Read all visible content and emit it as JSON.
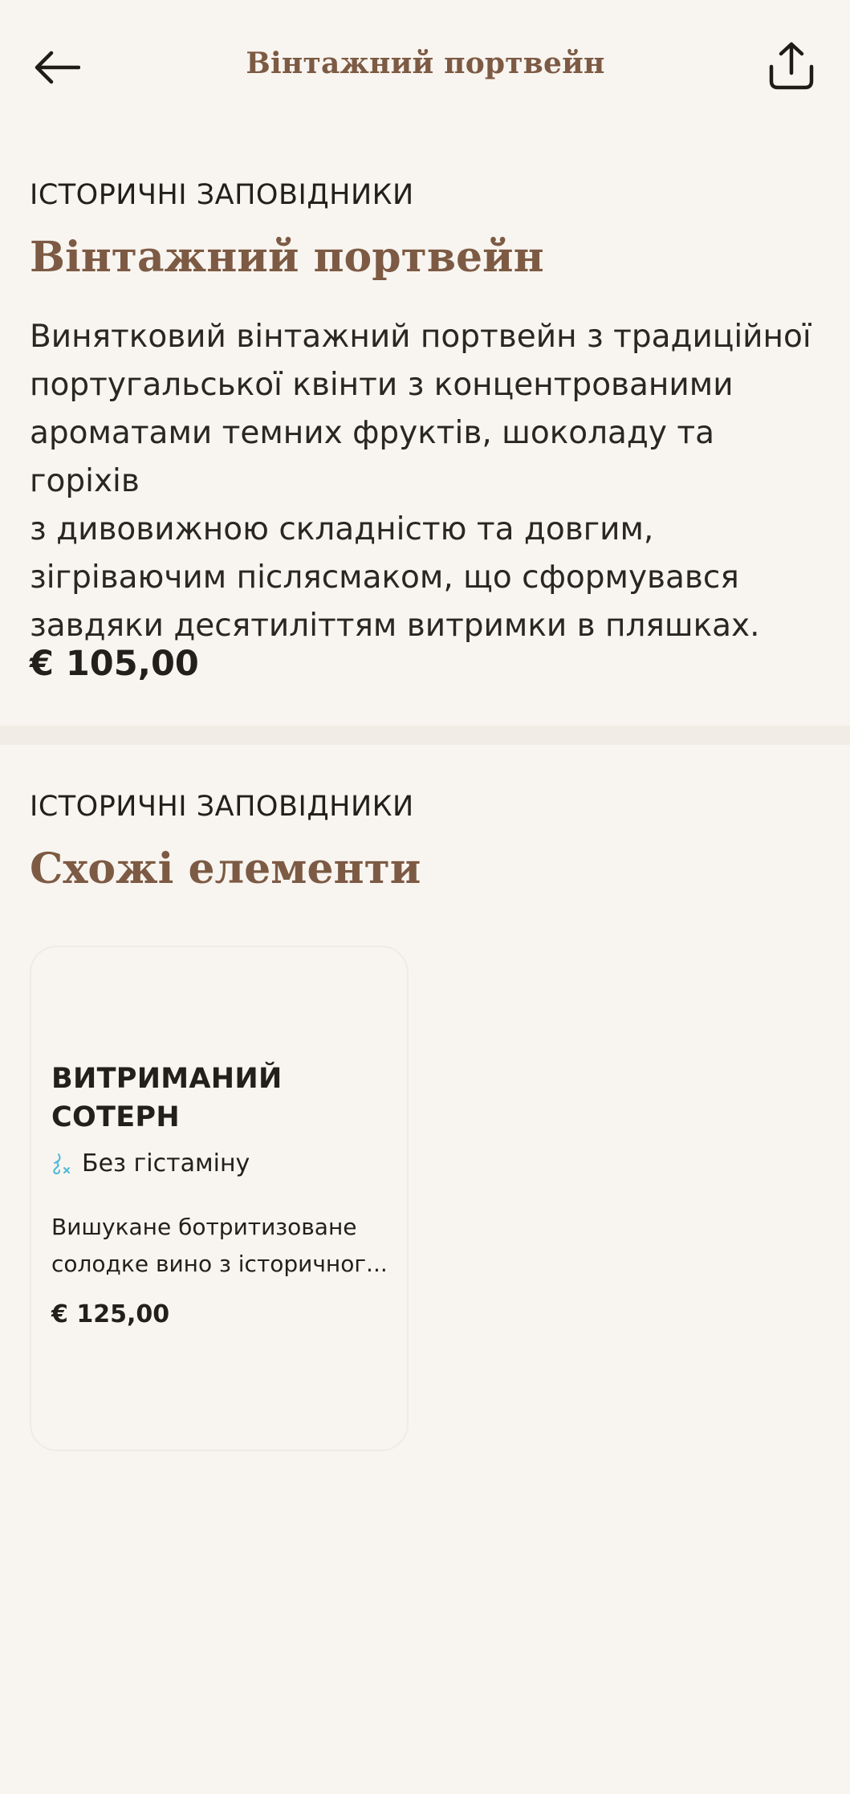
{
  "header": {
    "title": "Вінтажний портвейн",
    "back_icon": "arrow-left-icon",
    "share_icon": "share-icon"
  },
  "product": {
    "category": "ІСТОРИЧНІ ЗАПОВІДНИКИ",
    "name": "Вінтажний портвейн",
    "description_lines": [
      "Винятковий вінтажний портвейн з традиційної",
      "португальської квінти з концентрованими",
      "ароматами темних фруктів, шоколаду та горіхів",
      "з дивовижною складністю та довгим,",
      "зігріваючим післясмаком, що сформувався",
      "завдяки десятиліттям витримки в пляшках."
    ],
    "price": "€ 105,00"
  },
  "similar": {
    "category": "ІСТОРИЧНІ ЗАПОВІДНИКИ",
    "heading": "Схожі елементи",
    "items": [
      {
        "title_lines": [
          "ВИТРИМАНИЙ",
          "СОТЕРН"
        ],
        "tag_icon": "histamine-free-icon",
        "tag": "Без гістаміну",
        "description_lines": [
          "Вишукане ботритизоване",
          "солодке вино з історичног..."
        ],
        "price": "€ 125,00"
      }
    ]
  },
  "colors": {
    "background": "#f8f5f0",
    "accent_brown": "#7d5a44",
    "text": "#23201c",
    "divider": "#f1ede6",
    "tag_icon": "#4fb8d8"
  }
}
